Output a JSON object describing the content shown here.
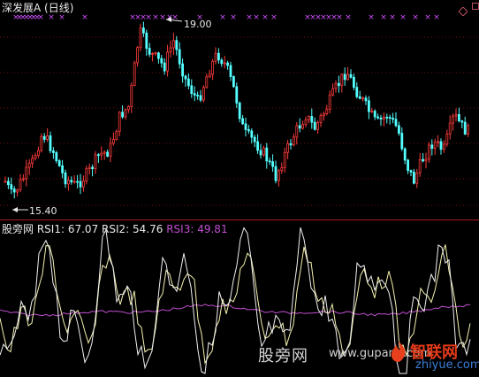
{
  "header": {
    "title": "深发展A",
    "period": "(日线)"
  },
  "price": {
    "high_label": "19.00",
    "low_label": "15.40",
    "colors": {
      "up": "#ff3b3b",
      "down": "#54ffff",
      "marker": "#d050ff"
    }
  },
  "indicator": {
    "source_label": "股旁网",
    "rsi1_label": "RSI1:",
    "rsi1_value": "67.07",
    "rsi2_label": "RSI2:",
    "rsi2_value": "54.76",
    "rsi3_label": "RSI3:",
    "rsi3_value": "49.81",
    "colors": {
      "rsi1": "#f0f0f0",
      "rsi2": "#f6f3b0",
      "rsi3": "#c04fd0"
    }
  },
  "watermarks": {
    "center": "股旁网",
    "domain": "www.gupang.com",
    "logo_text": "智联网",
    "logo_sub": "zhiyue.com"
  },
  "icons": {
    "marker_glyph": "×",
    "corner": "diamond-icon"
  }
}
